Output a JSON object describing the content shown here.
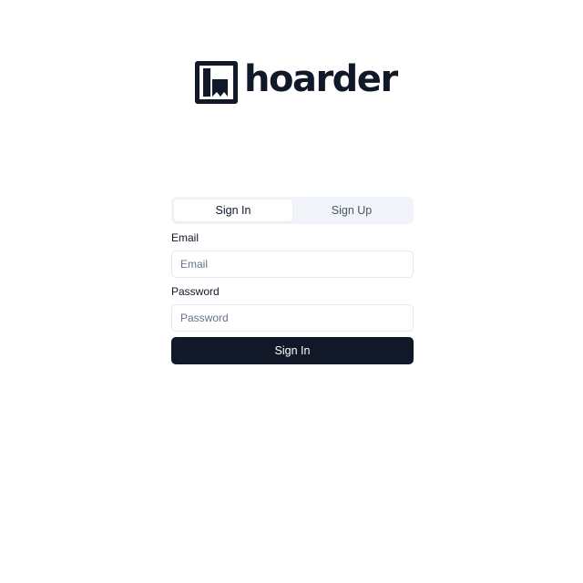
{
  "brand": {
    "name": "hoarder",
    "color": "#111827"
  },
  "auth": {
    "tabs": [
      {
        "label": "Sign In",
        "active": true
      },
      {
        "label": "Sign Up",
        "active": false
      }
    ],
    "email": {
      "label": "Email",
      "value": "",
      "placeholder": "Email"
    },
    "password": {
      "label": "Password",
      "value": "",
      "placeholder": "Password"
    },
    "submit_label": "Sign In"
  },
  "colors": {
    "primary": "#111827",
    "tab_track": "#f1f5f9",
    "border": "#e2e8f0",
    "placeholder": "#64748b"
  },
  "icons": {
    "logo": "hoarder-logo-icon"
  }
}
